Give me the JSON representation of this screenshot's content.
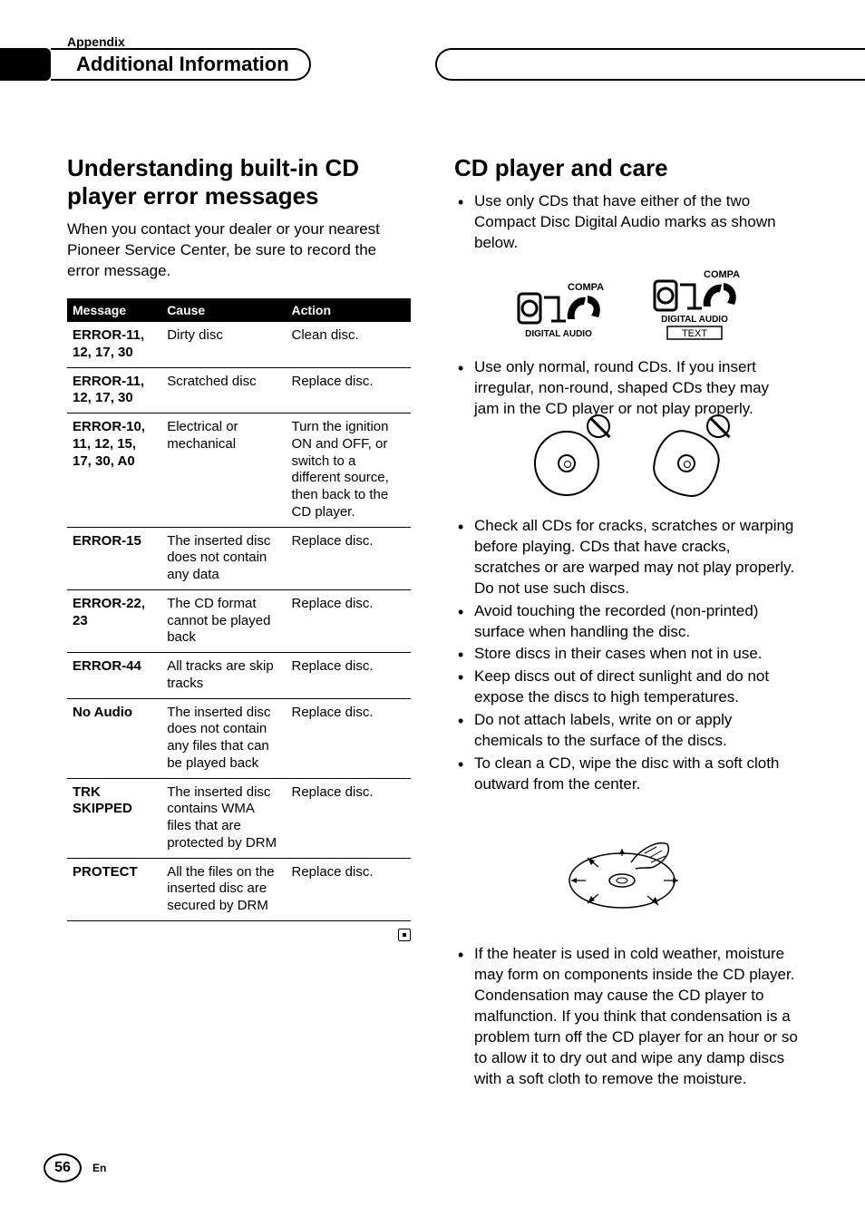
{
  "header": {
    "appendix_label": "Appendix",
    "section_heading": "Additional Information"
  },
  "left": {
    "title": "Understanding built-in CD player error messages",
    "intro": "When you contact your dealer or your nearest Pioneer Service Center, be sure to record the error message.",
    "table": {
      "headers": {
        "message": "Message",
        "cause": "Cause",
        "action": "Action"
      },
      "rows": [
        {
          "message": "ERROR-11, 12, 17, 30",
          "cause": "Dirty disc",
          "action": "Clean disc."
        },
        {
          "message": "ERROR-11, 12, 17, 30",
          "cause": "Scratched disc",
          "action": "Replace disc."
        },
        {
          "message": "ERROR-10, 11, 12, 15, 17, 30, A0",
          "cause": "Electrical or mechanical",
          "action": "Turn the ignition ON and OFF, or switch to a different source, then back to the CD player."
        },
        {
          "message": "ERROR-15",
          "cause": "The inserted disc does not contain any data",
          "action": "Replace disc."
        },
        {
          "message": "ERROR-22, 23",
          "cause": "The CD format cannot be played back",
          "action": "Replace disc."
        },
        {
          "message": "ERROR-44",
          "cause": "All tracks are skip tracks",
          "action": "Replace disc."
        },
        {
          "message": "No Audio",
          "cause": "The inserted disc does not contain any files that can be played back",
          "action": "Replace disc."
        },
        {
          "message": "TRK SKIPPED",
          "cause": "The inserted disc contains WMA files that are protected by DRM",
          "action": "Replace disc."
        },
        {
          "message": "PROTECT",
          "cause": "All the files on the inserted disc are secured by DRM",
          "action": "Replace disc."
        }
      ]
    }
  },
  "right": {
    "title": "CD player and care",
    "bullets_top": [
      "Use only CDs that have either of the two Compact Disc Digital Audio marks as shown below."
    ],
    "logo_labels": {
      "compact": "COMPACT",
      "disc": "DISC",
      "digital_audio": "DIGITAL AUDIO",
      "text": "TEXT"
    },
    "bullets_mid_first": [
      "Use only normal, round CDs. If you insert irregular, non-round, shaped CDs they may jam in the CD player or not play properly."
    ],
    "bullets_mid_rest": [
      "Check all CDs for cracks, scratches or warping before playing. CDs that have cracks, scratches or are warped may not play properly. Do not use such discs.",
      "Avoid touching the recorded (non-printed) surface when handling the disc.",
      "Store discs in their cases when not in use.",
      "Keep discs out of direct sunlight and do not expose the discs to high temperatures.",
      "Do not attach labels, write on or apply chemicals to the surface of the discs.",
      "To clean a CD, wipe the disc with a soft cloth outward from the center."
    ],
    "bullets_bottom": [
      "If the heater is used in cold weather, moisture may form on components inside the CD player. Condensation may cause the CD player to malfunction. If you think that condensation is a problem turn off the CD player for an hour or so to allow it to dry out and wipe any damp discs with a soft cloth to remove the moisture."
    ]
  },
  "footer": {
    "page_number": "56",
    "lang": "En"
  }
}
